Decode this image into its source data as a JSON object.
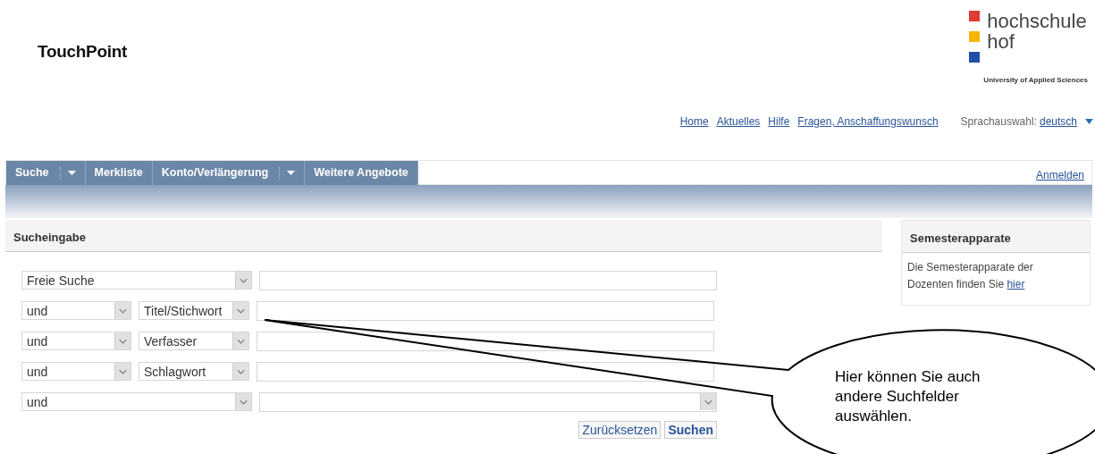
{
  "header": {
    "title": "TouchPoint",
    "logo": {
      "lines": [
        "hochschule",
        "hof"
      ],
      "tagline": "University of Applied Sciences"
    }
  },
  "top_links": [
    "Home",
    "Aktuelles",
    "Hilfe",
    "Fragen, Anschaffungswunsch"
  ],
  "language": {
    "label": "Sprachauswahl:",
    "value": "deutsch"
  },
  "nav": {
    "tabs": [
      {
        "label": "Suche",
        "dropdown": true
      },
      {
        "label": "Merkliste",
        "dropdown": false
      },
      {
        "label": "Konto/Verlängerung",
        "dropdown": true
      },
      {
        "label": "Weitere Angebote",
        "dropdown": false
      }
    ],
    "login": "Anmelden"
  },
  "search": {
    "title": "Sucheingabe",
    "rows": [
      {
        "kind": "single",
        "field": "Freie Suche",
        "input_dropdown": false
      },
      {
        "kind": "pair",
        "operator": "und",
        "field": "Titel/Stichwort",
        "input_dropdown": false
      },
      {
        "kind": "pair",
        "operator": "und",
        "field": "Verfasser",
        "input_dropdown": false
      },
      {
        "kind": "pair",
        "operator": "und",
        "field": "Schlagwort",
        "input_dropdown": false
      },
      {
        "kind": "single",
        "field": "und",
        "input_dropdown": true
      }
    ],
    "buttons": [
      {
        "label": "Zurücksetzen",
        "primary": false
      },
      {
        "label": "Suchen",
        "primary": true
      }
    ]
  },
  "side_panel": {
    "title": "Semesterapparate",
    "text": "Die Semesterapparate der Dozenten finden Sie",
    "link": "hier"
  },
  "callout": {
    "text": "Hier können Sie auch andere Suchfelder auswählen."
  }
}
